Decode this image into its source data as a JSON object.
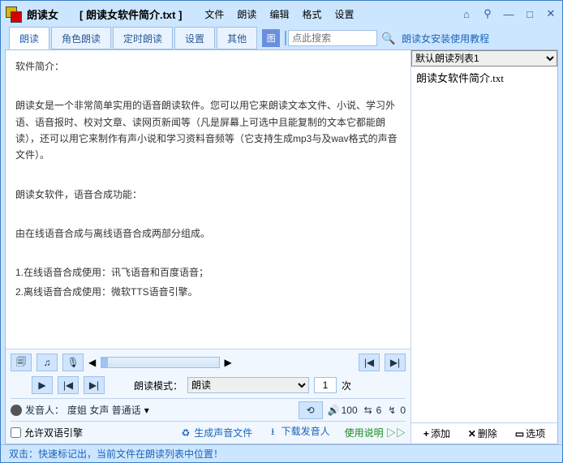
{
  "title": {
    "app": "朗读女",
    "doc": "[ 朗读女软件简介.txt ]"
  },
  "menu": [
    "文件",
    "朗读",
    "编辑",
    "格式",
    "设置"
  ],
  "tabs": [
    "朗读",
    "角色朗读",
    "定时朗读",
    "设置",
    "其他"
  ],
  "search": {
    "placeholder": "点此搜索"
  },
  "tutorial": "朗读女安装使用教程",
  "editor": {
    "p1": "软件简介：",
    "p2": "朗读女是一个非常简单实用的语音朗读软件。您可以用它来朗读文本文件、小说、学习外语、语音报时、校对文章、读网页新闻等（凡是屏幕上可选中且能复制的文本它都能朗读），还可以用它来制作有声小说和学习资料音频等（它支持生成mp3与及wav格式的声音文件）。",
    "p3": "朗读女软件，语音合成功能：",
    "p4": "由在线语音合成与离线语音合成两部分组成。",
    "p5": "1.在线语音合成使用：讯飞语音和百度语音；",
    "p6": "2.离线语音合成使用：微软TTS语音引擎。"
  },
  "ctrl": {
    "mode_label": "朗读模式：",
    "mode_value": "朗读",
    "count": "1",
    "count_suffix": "次",
    "speaker_label": "发音人：",
    "speaker": "度姐 女声 普通话",
    "vol": "100",
    "speed": "6",
    "pitch": "0",
    "allow_dual": "允许双语引擎",
    "gen_audio": "生成声音文件",
    "dl_speaker": "下载发音人",
    "help": "使用说明"
  },
  "right": {
    "list_name": "默认朗读列表1",
    "item1": "朗读女软件简介.txt",
    "add": "添加",
    "del": "删除",
    "opt": "选项"
  },
  "status": "双击：快速标记出，当前文件在朗读列表中位置！"
}
